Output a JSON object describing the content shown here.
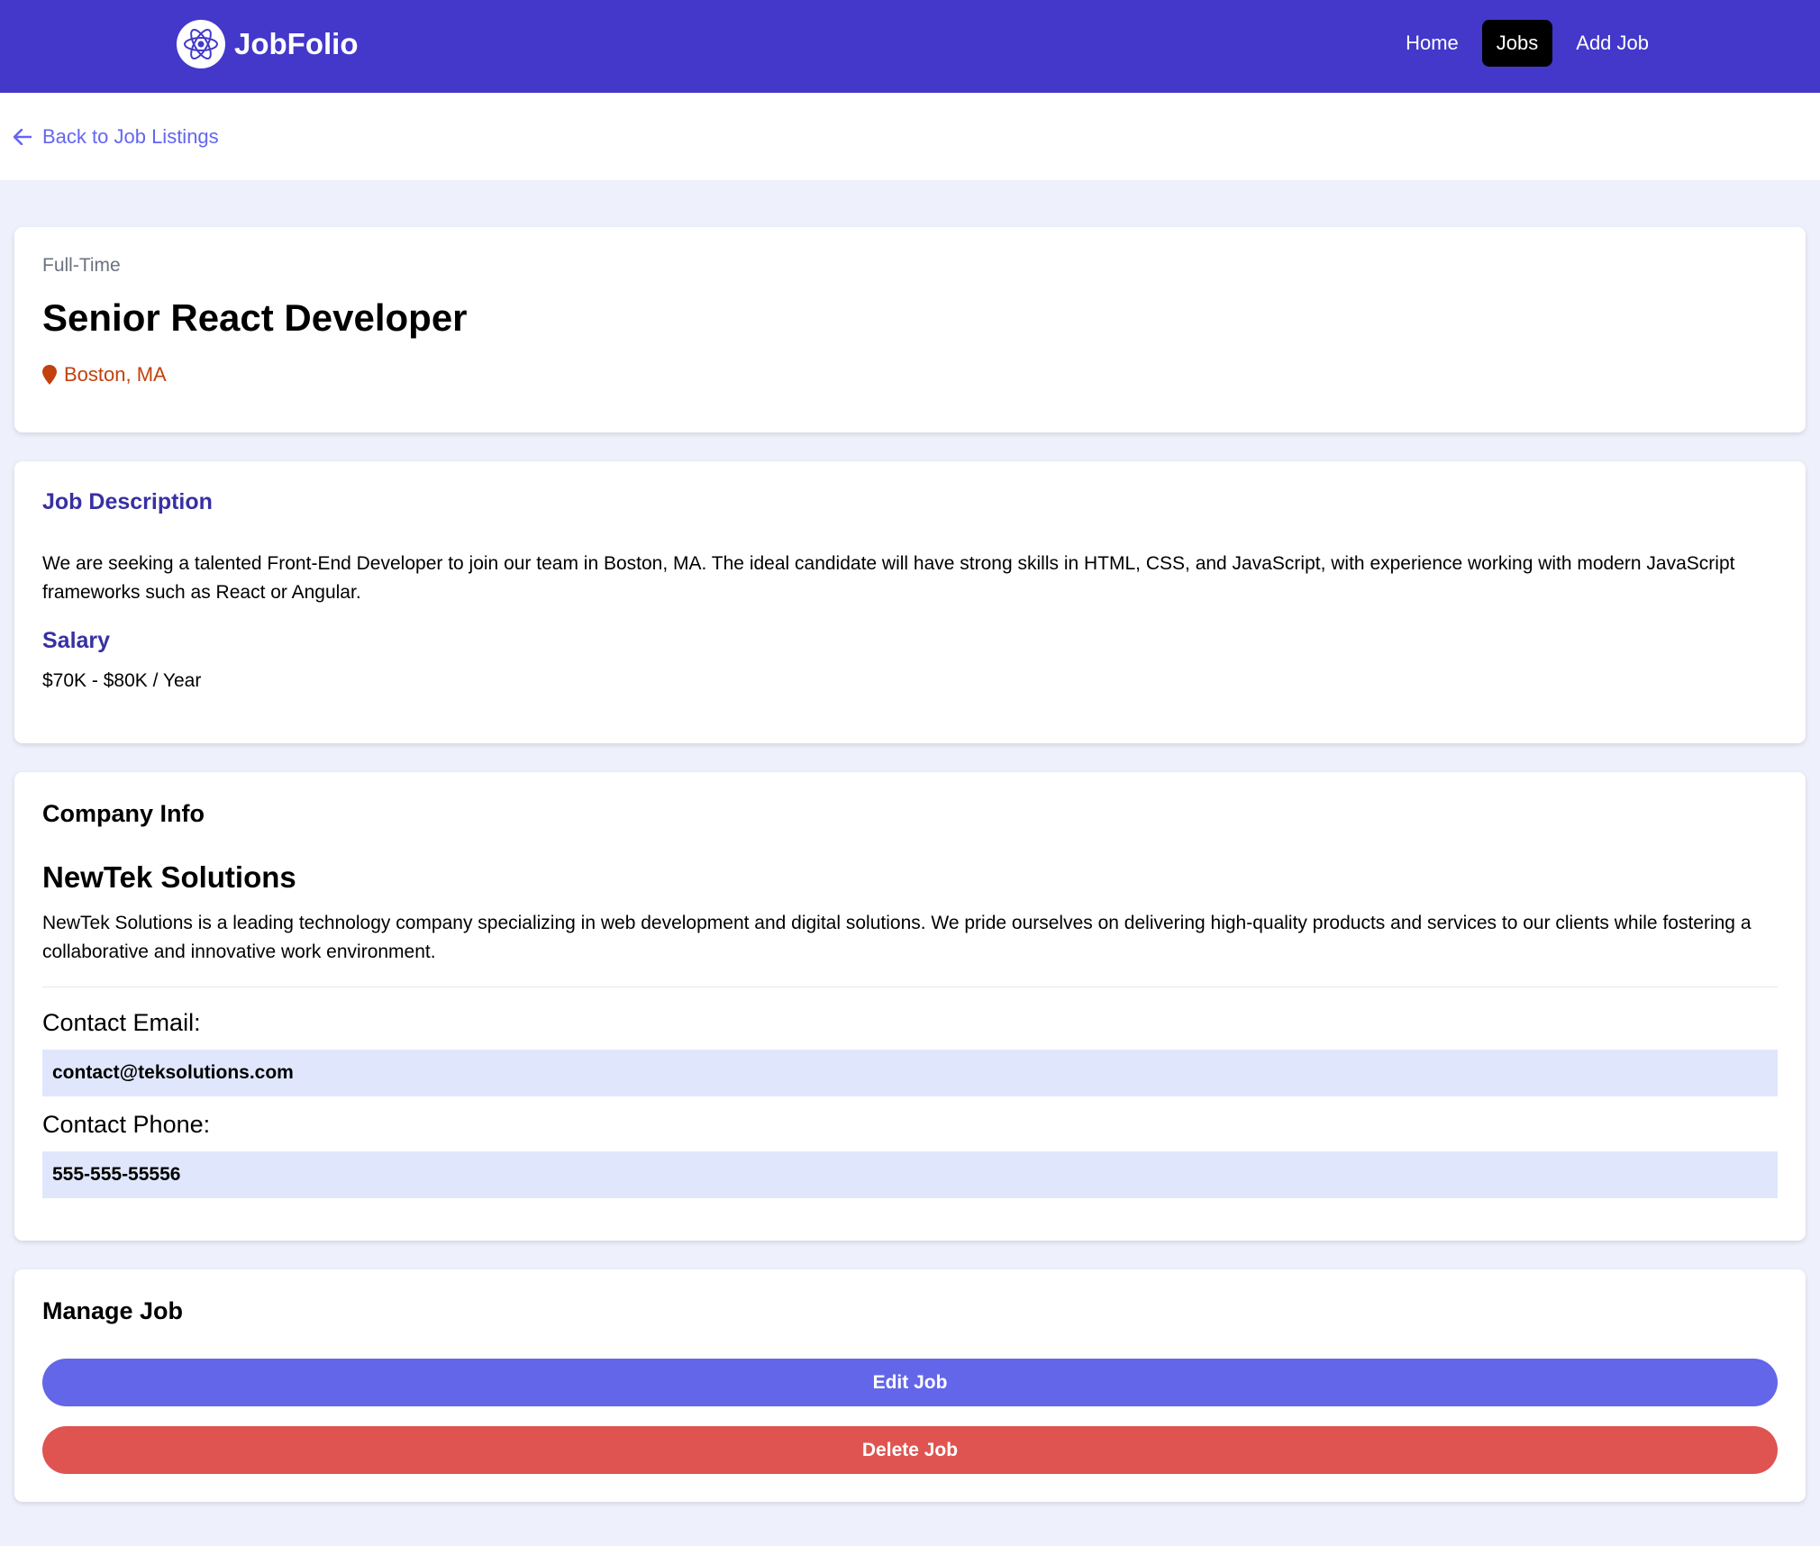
{
  "navbar": {
    "brand": "JobFolio",
    "links": [
      {
        "label": "Home"
      },
      {
        "label": "Jobs"
      },
      {
        "label": "Add Job"
      }
    ],
    "bg_color": "#4338ca"
  },
  "back_link": "Back to Job Listings",
  "job": {
    "type": "Full-Time",
    "title": "Senior React Developer",
    "location": "Boston, MA",
    "description_title": "Job Description",
    "description": "We are seeking a talented Front-End Developer to join our team in Boston, MA. The ideal candidate will have strong skills in HTML, CSS, and JavaScript, with experience working with modern JavaScript frameworks such as React or Angular.",
    "salary_title": "Salary",
    "salary": "$70K - $80K / Year"
  },
  "company": {
    "heading": "Company Info",
    "name": "NewTek Solutions",
    "description": "NewTek Solutions is a leading technology company specializing in web development and digital solutions. We pride ourselves on delivering high-quality products and services to our clients while fostering a collaborative and innovative work environment.",
    "email_label": "Contact Email:",
    "email": "contact@teksolutions.com",
    "phone_label": "Contact Phone:",
    "phone": "555-555-55556"
  },
  "manage": {
    "heading": "Manage Job",
    "edit_label": "Edit Job",
    "delete_label": "Delete Job"
  },
  "colors": {
    "accent": "#6366f1",
    "delete": "#df5450",
    "location": "#c2410c"
  }
}
